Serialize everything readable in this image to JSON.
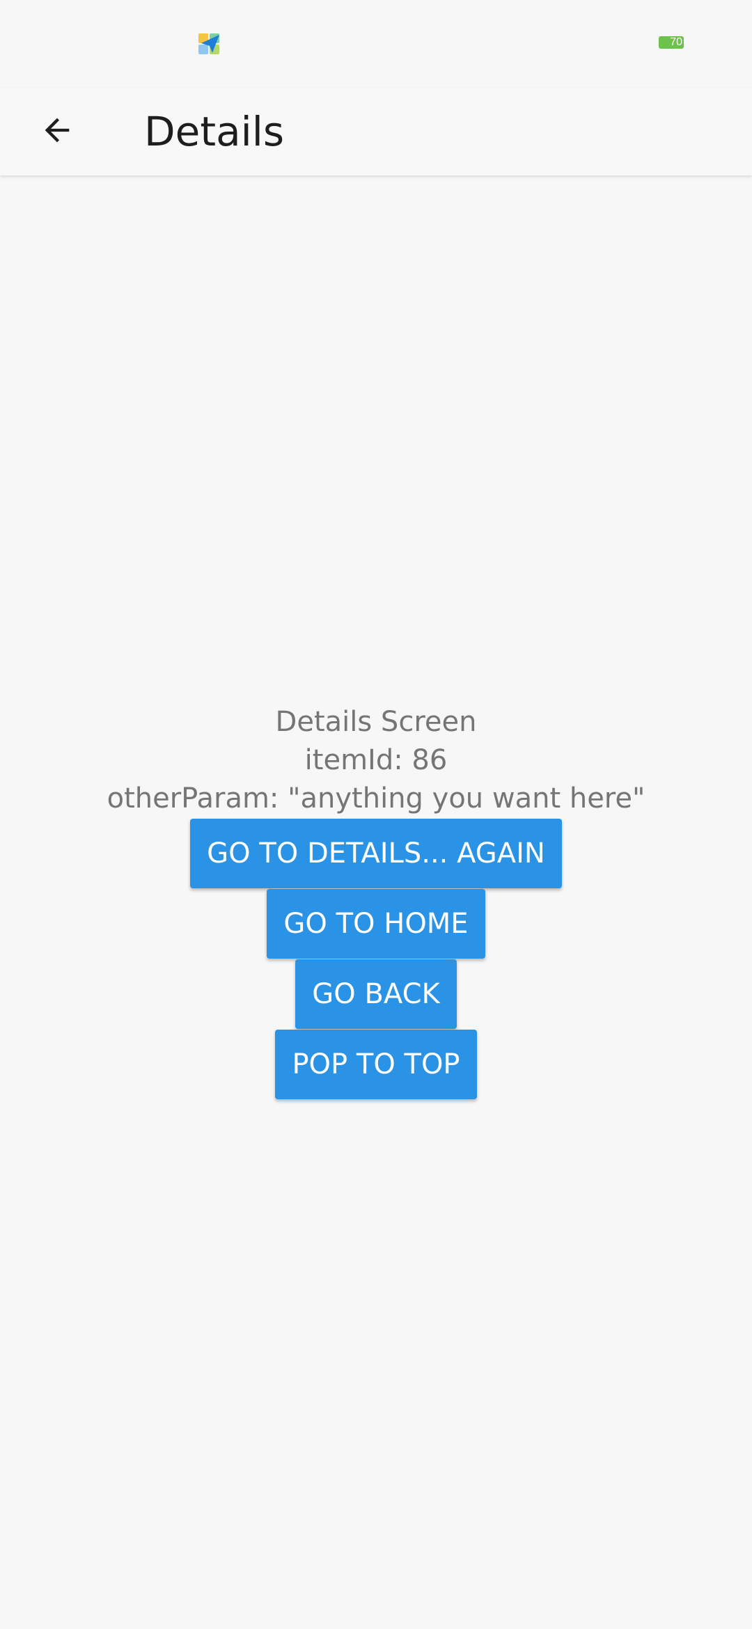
{
  "status_bar": {
    "battery_level": "70",
    "battery_color": "#6cc24a",
    "app_icon": "paper-plane-app-icon"
  },
  "app_bar": {
    "title": "Details",
    "back_icon": "arrow-back-icon"
  },
  "screen": {
    "heading": "Details Screen",
    "item_id_text": "itemId: 86",
    "other_param_text": "otherParam: \"anything you want here\""
  },
  "buttons": {
    "go_to_details_again": "GO TO DETAILS... AGAIN",
    "go_to_home": "GO TO HOME",
    "go_back": "GO BACK",
    "pop_to_top": "POP TO TOP"
  },
  "colors": {
    "button_bg": "#2b93e6",
    "button_text": "#ffffff",
    "body_text": "#757575",
    "background": "#f7f7f7"
  }
}
